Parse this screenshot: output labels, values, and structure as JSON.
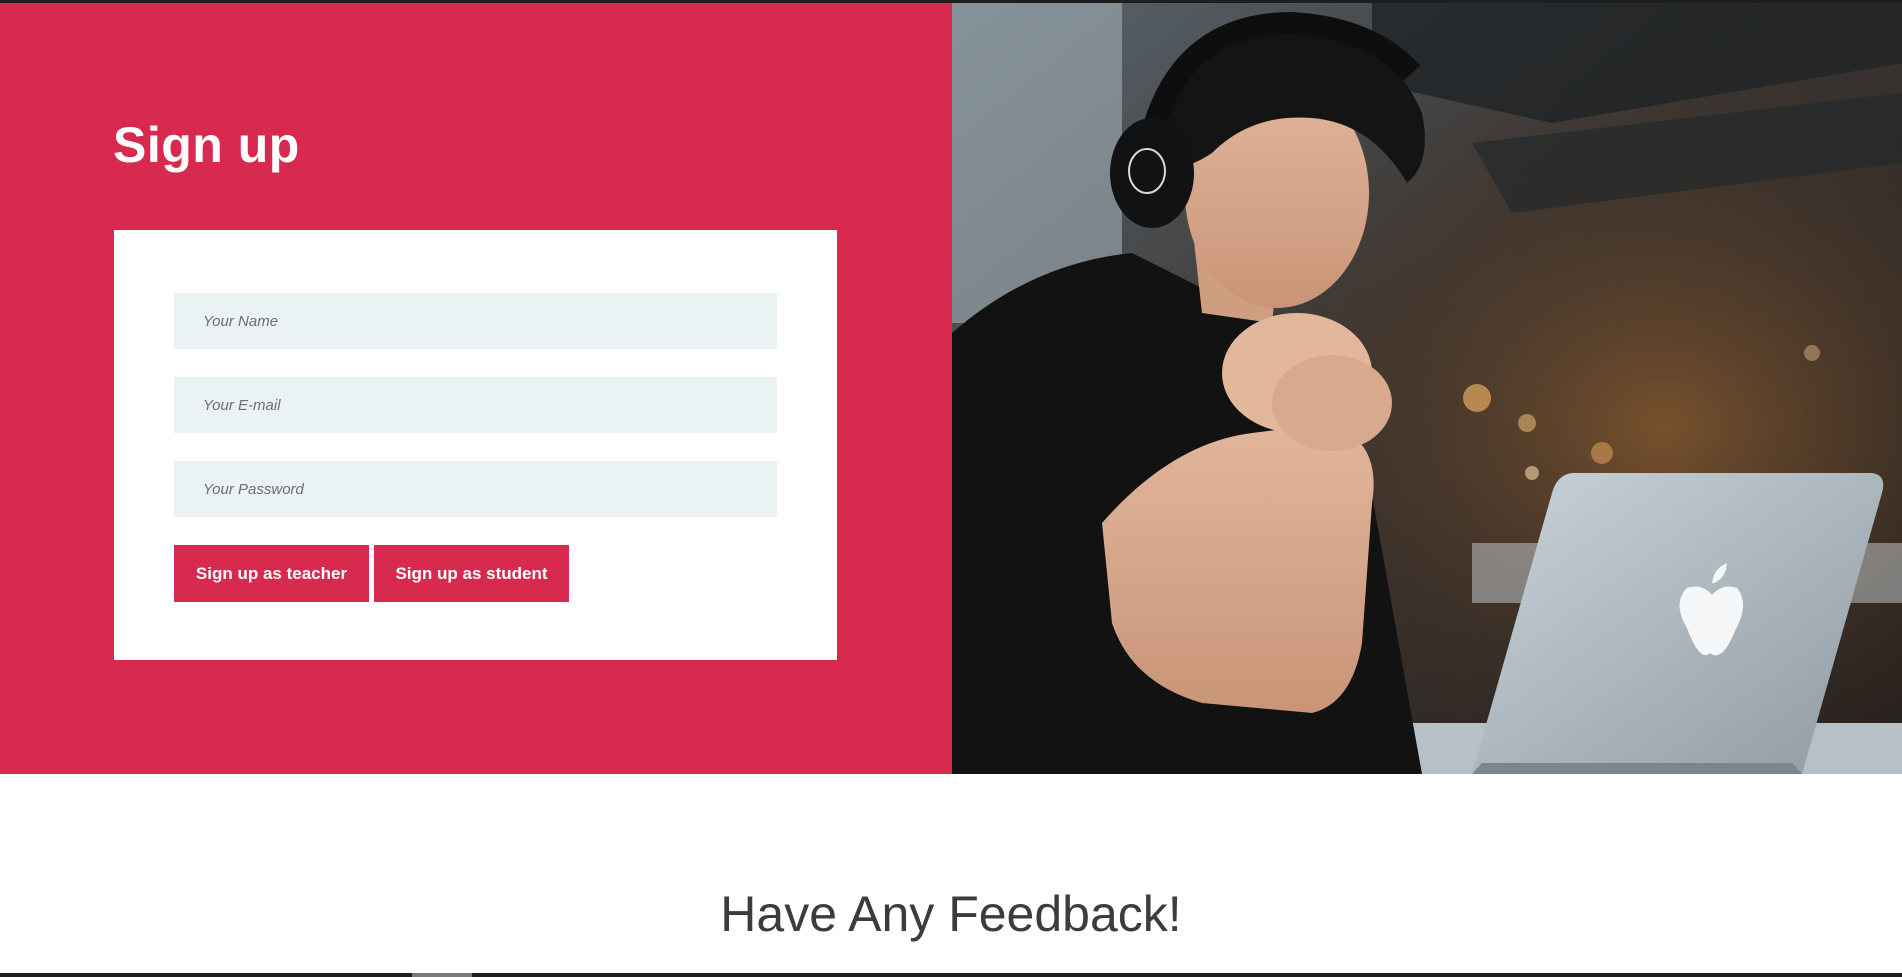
{
  "signup": {
    "title": "Sign up",
    "fields": {
      "name_placeholder": "Your Name",
      "email_placeholder": "Your E-mail",
      "password_placeholder": "Your Password"
    },
    "buttons": {
      "teacher_label": "Sign up as teacher",
      "student_label": "Sign up as student"
    }
  },
  "feedback": {
    "title": "Have Any Feedback!"
  },
  "colors": {
    "brand": "#d82a4e",
    "field_background": "#ebf2f3",
    "heading_text": "#3c3c3c"
  },
  "hero_image": {
    "subject": "person-with-headphones-at-laptop-illustration"
  }
}
